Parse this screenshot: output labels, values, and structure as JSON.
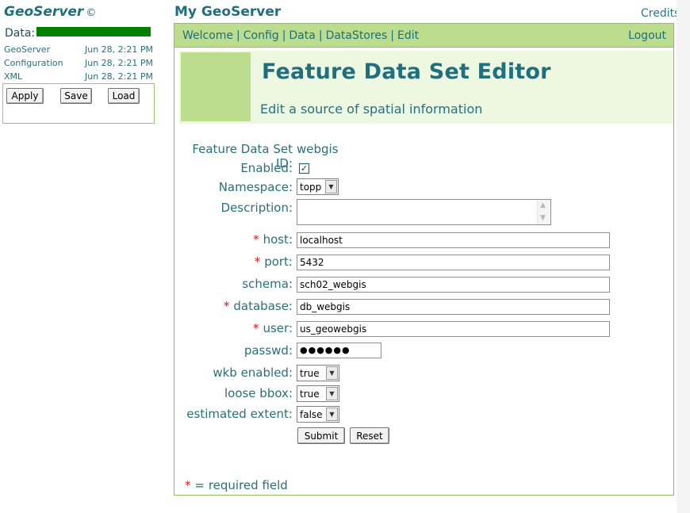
{
  "sidebar": {
    "brand": "GeoServer",
    "brand_mark": "©",
    "data_label": "Data:",
    "status": [
      {
        "name": "GeoServer",
        "time": "Jun 28, 2:21 PM"
      },
      {
        "name": "Configuration",
        "time": "Jun 28, 2:21 PM"
      },
      {
        "name": "XML",
        "time": "Jun 28, 2:21 PM"
      }
    ],
    "buttons": {
      "apply": "Apply",
      "save": "Save",
      "load": "Load"
    }
  },
  "header": {
    "title": "My GeoServer",
    "credits": "Credits"
  },
  "nav": {
    "links": [
      "Welcome",
      "Config",
      "Data",
      "DataStores",
      "Edit"
    ],
    "separator": "|",
    "logout": "Logout"
  },
  "hero": {
    "title": "Feature Data Set Editor",
    "subtitle": "Edit a source of spatial information"
  },
  "form": {
    "id_label": "Feature Data Set ID:",
    "id_value": "webgis",
    "enabled_label": "Enabled:",
    "enabled_check": "✓",
    "namespace_label": "Namespace:",
    "namespace_value": "topp",
    "description_label": "Description:",
    "required_mark": "*",
    "host_label": "host:",
    "host_value": "localhost",
    "port_label": "port:",
    "port_value": "5432",
    "schema_label": "schema:",
    "schema_value": "sch02_webgis",
    "database_label": "database:",
    "database_value": "db_webgis",
    "user_label": "user:",
    "user_value": "us_geowebgis",
    "passwd_label": "passwd:",
    "passwd_value": "●●●●●●",
    "wkb_label": "wkb enabled:",
    "wkb_value": "true",
    "loose_label": "loose bbox:",
    "loose_value": "true",
    "estimated_label": "estimated extent:",
    "estimated_value": "false",
    "submit": "Submit",
    "reset": "Reset",
    "required_note": "= required field"
  }
}
